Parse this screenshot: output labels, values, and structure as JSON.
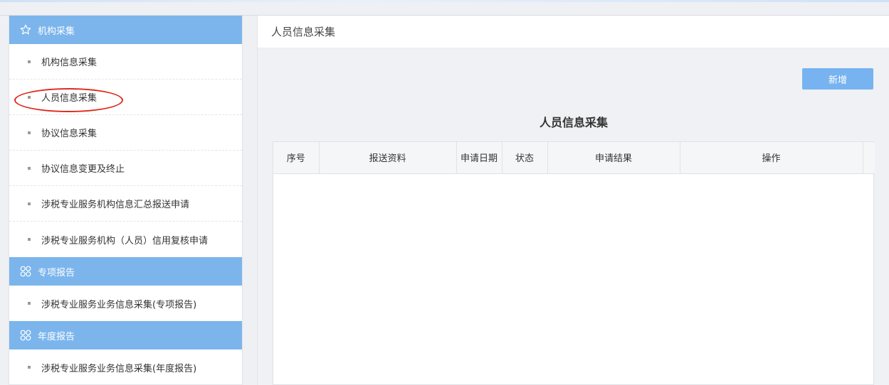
{
  "sidebar": {
    "groups": [
      {
        "label": "机构采集",
        "icon": "star-icon",
        "items": [
          "机构信息采集",
          "人员信息采集",
          "协议信息采集",
          "协议信息变更及终止",
          "涉税专业服务机构信息汇总报送申请",
          "涉税专业服务机构（人员）信用复核申请"
        ]
      },
      {
        "label": "专项报告",
        "icon": "grid-icon",
        "items": [
          "涉税专业服务业务信息采集(专项报告)"
        ]
      },
      {
        "label": "年度报告",
        "icon": "grid-icon",
        "items": [
          "涉税专业服务业务信息采集(年度报告)"
        ]
      }
    ],
    "highlighted_item": "人员信息采集"
  },
  "main": {
    "header_title": "人员信息采集",
    "add_button_label": "新增",
    "section_title": "人员信息采集",
    "table": {
      "columns": [
        "序号",
        "报送资料",
        "申请日期",
        "状态",
        "申请结果",
        "操作"
      ],
      "rows": []
    }
  },
  "colors": {
    "group_header_bg": "#7cb5ec",
    "add_button_bg": "#77b3f0",
    "highlight_circle": "#e0281e"
  }
}
